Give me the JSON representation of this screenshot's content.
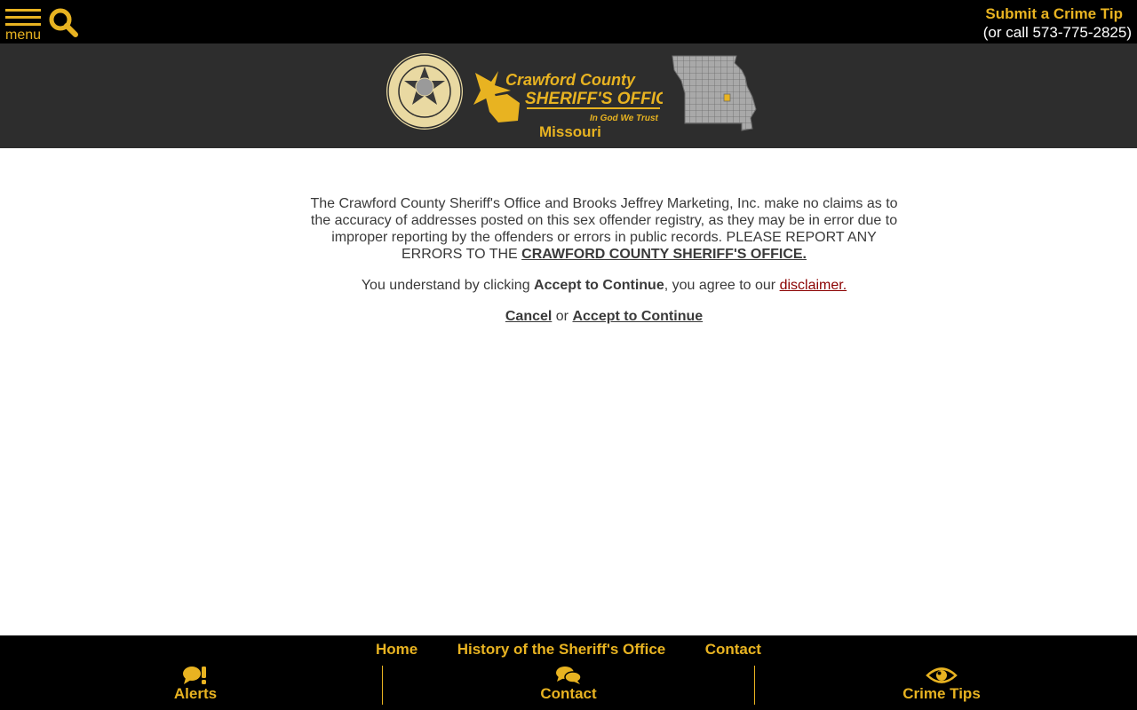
{
  "topbar": {
    "menu_label": "menu",
    "tip_link": "Submit a Crime Tip",
    "tip_phone": "(or call 573-775-2825)"
  },
  "header": {
    "state_label": "Missouri",
    "logo_line1": "Crawford County",
    "logo_line2": "SHERIFF'S OFFICE",
    "logo_motto": "In God We Trust"
  },
  "main": {
    "notice_text": "The Crawford County Sheriff's Office and Brooks Jeffrey Marketing, Inc. make no claims as to the accuracy of addresses posted on this sex offender registry, as they may be in error due to improper reporting by the offenders or errors in public records. PLEASE REPORT ANY ERRORS TO THE ",
    "notice_link": "CRAWFORD COUNTY SHERIFF'S OFFICE.",
    "agree_prefix": "You understand by clicking ",
    "agree_bold": "Accept to Continue",
    "agree_middle": ", you agree to our ",
    "disclaimer_link": "disclaimer.",
    "cancel_label": "Cancel",
    "or_label": "or",
    "accept_label": "Accept to Continue"
  },
  "footer": {
    "nav": [
      "Home",
      "History of the Sheriff's Office",
      "Contact"
    ],
    "tabs": {
      "alerts": "Alerts",
      "contact": "Contact",
      "tips": "Crime Tips"
    }
  },
  "colors": {
    "accent": "#e8b321",
    "header_bg": "#2d2d2d",
    "topbar_bg": "#000000",
    "link_red": "#8b0000"
  },
  "icons": {
    "menu": "hamburger-icon",
    "search": "search-icon",
    "alerts": "alert-bubble-icon",
    "contact": "chat-bubbles-icon",
    "tips": "eye-icon"
  }
}
